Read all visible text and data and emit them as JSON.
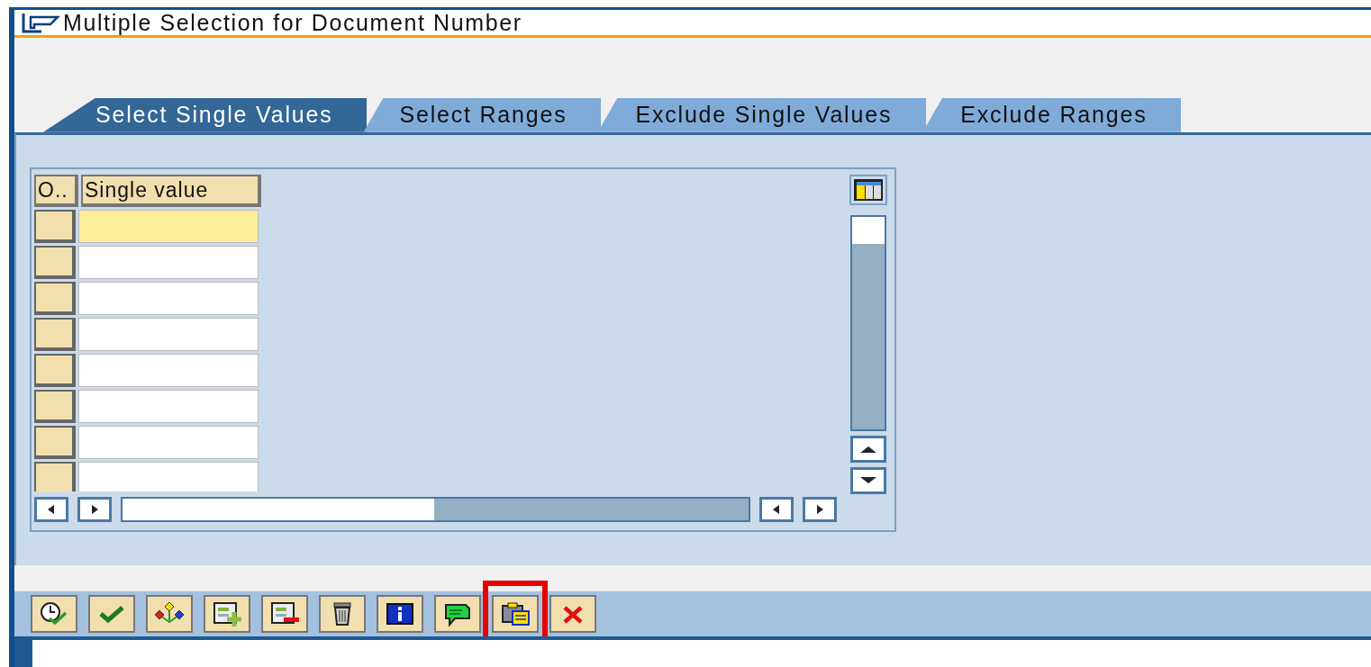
{
  "window": {
    "title": "Multiple Selection for Document Number"
  },
  "tabs": [
    {
      "label": "Select Single Values",
      "selected": true
    },
    {
      "label": "Select Ranges",
      "selected": false
    },
    {
      "label": "Exclude Single Values",
      "selected": false
    },
    {
      "label": "Exclude Ranges",
      "selected": false
    }
  ],
  "table": {
    "columns": [
      "O..",
      "Single value"
    ],
    "rows": [
      {
        "selected": true
      },
      {
        "selected": false
      },
      {
        "selected": false
      },
      {
        "selected": false
      },
      {
        "selected": false
      },
      {
        "selected": false
      },
      {
        "selected": false
      },
      {
        "selected": false
      }
    ]
  },
  "toolbar": {
    "buttons": [
      {
        "kind": "history",
        "highlighted": false
      },
      {
        "kind": "check",
        "highlighted": false
      },
      {
        "kind": "hierarchy",
        "highlighted": false
      },
      {
        "kind": "insert",
        "highlighted": false
      },
      {
        "kind": "remove",
        "highlighted": false
      },
      {
        "kind": "trash",
        "highlighted": false
      },
      {
        "kind": "info",
        "highlighted": false
      },
      {
        "kind": "comment",
        "highlighted": false
      },
      {
        "kind": "paste",
        "highlighted": true
      },
      {
        "kind": "cancel",
        "highlighted": false
      }
    ]
  }
}
